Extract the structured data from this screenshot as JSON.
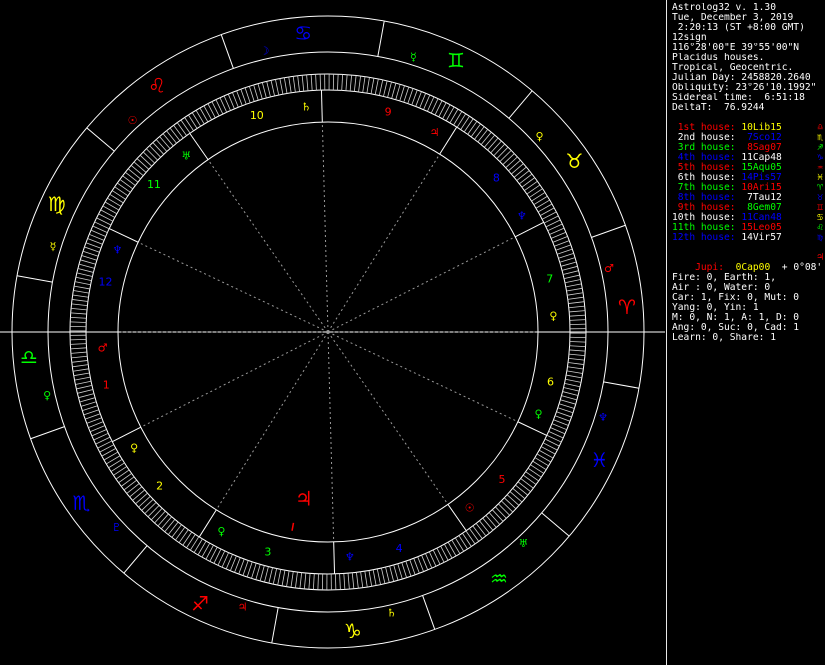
{
  "header": {
    "title": "Astrolog32 v. 1.30",
    "date": "Tue, December 3, 2019",
    "time": " 2:20:13 (ST +8:00 GMT)",
    "signs": "12sign",
    "location": "116°28'00\"E 39°55'00\"N",
    "house_system": "Placidus houses.",
    "zodiac": "Tropical, Geocentric.",
    "julian_day": "Julian Day: 2458820.2640",
    "obliquity": "Obliquity: 23°26'10.1992\"",
    "sidereal_time": "Sidereal time:  6:51:18",
    "delta_t": "DeltaT:  76.9244"
  },
  "houses": [
    {
      "label": "1st house:",
      "value": "10Lib15",
      "label_color": "#ff0000",
      "value_color": "#ffff00",
      "symbol": "♎",
      "symbol_color": "#ff0000"
    },
    {
      "label": "2nd house:",
      "value": " 7Sco12",
      "label_color": "#ffffff",
      "value_color": "#0000ff",
      "symbol": "♏",
      "symbol_color": "#ffff00"
    },
    {
      "label": "3rd house:",
      "value": " 8Sag07",
      "label_color": "#00ff00",
      "value_color": "#ff0000",
      "symbol": "♐",
      "symbol_color": "#00ff00"
    },
    {
      "label": "4th house:",
      "value": "11Cap48",
      "label_color": "#0000ff",
      "value_color": "#ffffff",
      "symbol": "♑",
      "symbol_color": "#0000ff"
    },
    {
      "label": "5th house:",
      "value": "15Aqu05",
      "label_color": "#ff0000",
      "value_color": "#00ff00",
      "symbol": "♒",
      "symbol_color": "#ff0000"
    },
    {
      "label": "6th house:",
      "value": "14Pis57",
      "label_color": "#ffffff",
      "value_color": "#0000ff",
      "symbol": "♓",
      "symbol_color": "#ffff00"
    },
    {
      "label": "7th house:",
      "value": "10Ari15",
      "label_color": "#00ff00",
      "value_color": "#ff0000",
      "symbol": "♈",
      "symbol_color": "#00ff00"
    },
    {
      "label": "8th house:",
      "value": " 7Tau12",
      "label_color": "#0000ff",
      "value_color": "#ffffff",
      "symbol": "♉",
      "symbol_color": "#0000ff"
    },
    {
      "label": "9th house:",
      "value": " 8Gem07",
      "label_color": "#ff0000",
      "value_color": "#00ff00",
      "symbol": "♊",
      "symbol_color": "#ff0000"
    },
    {
      "label": "10th house:",
      "value": "11Can48",
      "label_color": "#ffffff",
      "value_color": "#0000ff",
      "symbol": "♋",
      "symbol_color": "#ffff00"
    },
    {
      "label": "11th house:",
      "value": "15Leo05",
      "label_color": "#00ff00",
      "value_color": "#ff0000",
      "symbol": "♌",
      "symbol_color": "#00ff00"
    },
    {
      "label": "12th house:",
      "value": "14Vir57",
      "label_color": "#0000ff",
      "value_color": "#ffffff",
      "symbol": "♍",
      "symbol_color": "#0000ff"
    }
  ],
  "jupiter_line": {
    "label": "Jupi:",
    "value": "0Cap00",
    "motion": "+ 0°08'",
    "label_color": "#ff0000",
    "value_color": "#ffff00",
    "symbol": "♃",
    "symbol_color": "#ff0000"
  },
  "stats": [
    "Fire: 0, Earth: 1,",
    "Air : 0, Water: 0",
    "Car: 1, Fix: 0, Mut: 0",
    "Yang: 0, Yin: 1",
    "M: 0, N: 1, A: 1, D: 0",
    "Ang: 0, Suc: 0, Cad: 1",
    "Learn: 0, Share: 1"
  ],
  "chart": {
    "sign_glyphs": [
      {
        "glyph": "♈",
        "color": "#ff0000"
      },
      {
        "glyph": "♉",
        "color": "#ffff00"
      },
      {
        "glyph": "♊",
        "color": "#00ff00"
      },
      {
        "glyph": "♋",
        "color": "#0000ff"
      },
      {
        "glyph": "♌",
        "color": "#ff0000"
      },
      {
        "glyph": "♍",
        "color": "#ffff00"
      },
      {
        "glyph": "♎",
        "color": "#00ff00"
      },
      {
        "glyph": "♏",
        "color": "#0000ff"
      },
      {
        "glyph": "♐",
        "color": "#ff0000"
      },
      {
        "glyph": "♑",
        "color": "#ffff00"
      },
      {
        "glyph": "♒",
        "color": "#00ff00"
      },
      {
        "glyph": "♓",
        "color": "#0000ff"
      }
    ],
    "ruler_glyphs": [
      {
        "glyph": "♂",
        "color": "#ff0000"
      },
      {
        "glyph": "♀",
        "color": "#ffff00"
      },
      {
        "glyph": "☿",
        "color": "#00ff00"
      },
      {
        "glyph": "☽",
        "color": "#0000ff"
      },
      {
        "glyph": "☉",
        "color": "#ff0000"
      },
      {
        "glyph": "☿",
        "color": "#ffff00"
      },
      {
        "glyph": "♀",
        "color": "#00ff00"
      },
      {
        "glyph": "♇",
        "color": "#0000ff"
      },
      {
        "glyph": "♃",
        "color": "#ff0000"
      },
      {
        "glyph": "♄",
        "color": "#ffff00"
      },
      {
        "glyph": "♅",
        "color": "#00ff00"
      },
      {
        "glyph": "♆",
        "color": "#0000ff"
      }
    ],
    "house_numbers": [
      {
        "num": "1",
        "color": "#ff0000"
      },
      {
        "num": "2",
        "color": "#ffff00"
      },
      {
        "num": "3",
        "color": "#00ff00"
      },
      {
        "num": "4",
        "color": "#0000ff"
      },
      {
        "num": "5",
        "color": "#ff0000"
      },
      {
        "num": "6",
        "color": "#ffff00"
      },
      {
        "num": "7",
        "color": "#00ff00"
      },
      {
        "num": "8",
        "color": "#0000ff"
      },
      {
        "num": "9",
        "color": "#ff0000"
      },
      {
        "num": "10",
        "color": "#ffff00"
      },
      {
        "num": "11",
        "color": "#00ff00"
      },
      {
        "num": "12",
        "color": "#0000ff"
      }
    ],
    "house_rulers": [
      {
        "glyph": "♂",
        "color": "#ff0000"
      },
      {
        "glyph": "♀",
        "color": "#ffff00"
      },
      {
        "glyph": "♀",
        "color": "#00ff00"
      },
      {
        "glyph": "♆",
        "color": "#0000ff"
      },
      {
        "glyph": "☉",
        "color": "#ff0000"
      },
      {
        "glyph": "♀",
        "color": "#00ff00"
      },
      {
        "glyph": "♀",
        "color": "#ffff00"
      },
      {
        "glyph": "♆",
        "color": "#0000ff"
      },
      {
        "glyph": "♃",
        "color": "#ff0000"
      },
      {
        "glyph": "♄",
        "color": "#ffff00"
      },
      {
        "glyph": "♅",
        "color": "#00ff00"
      },
      {
        "glyph": "♆",
        "color": "#0000ff"
      }
    ],
    "planet": {
      "glyph": "♃",
      "color": "#ff0000",
      "tick_color": "#ff0000"
    }
  }
}
